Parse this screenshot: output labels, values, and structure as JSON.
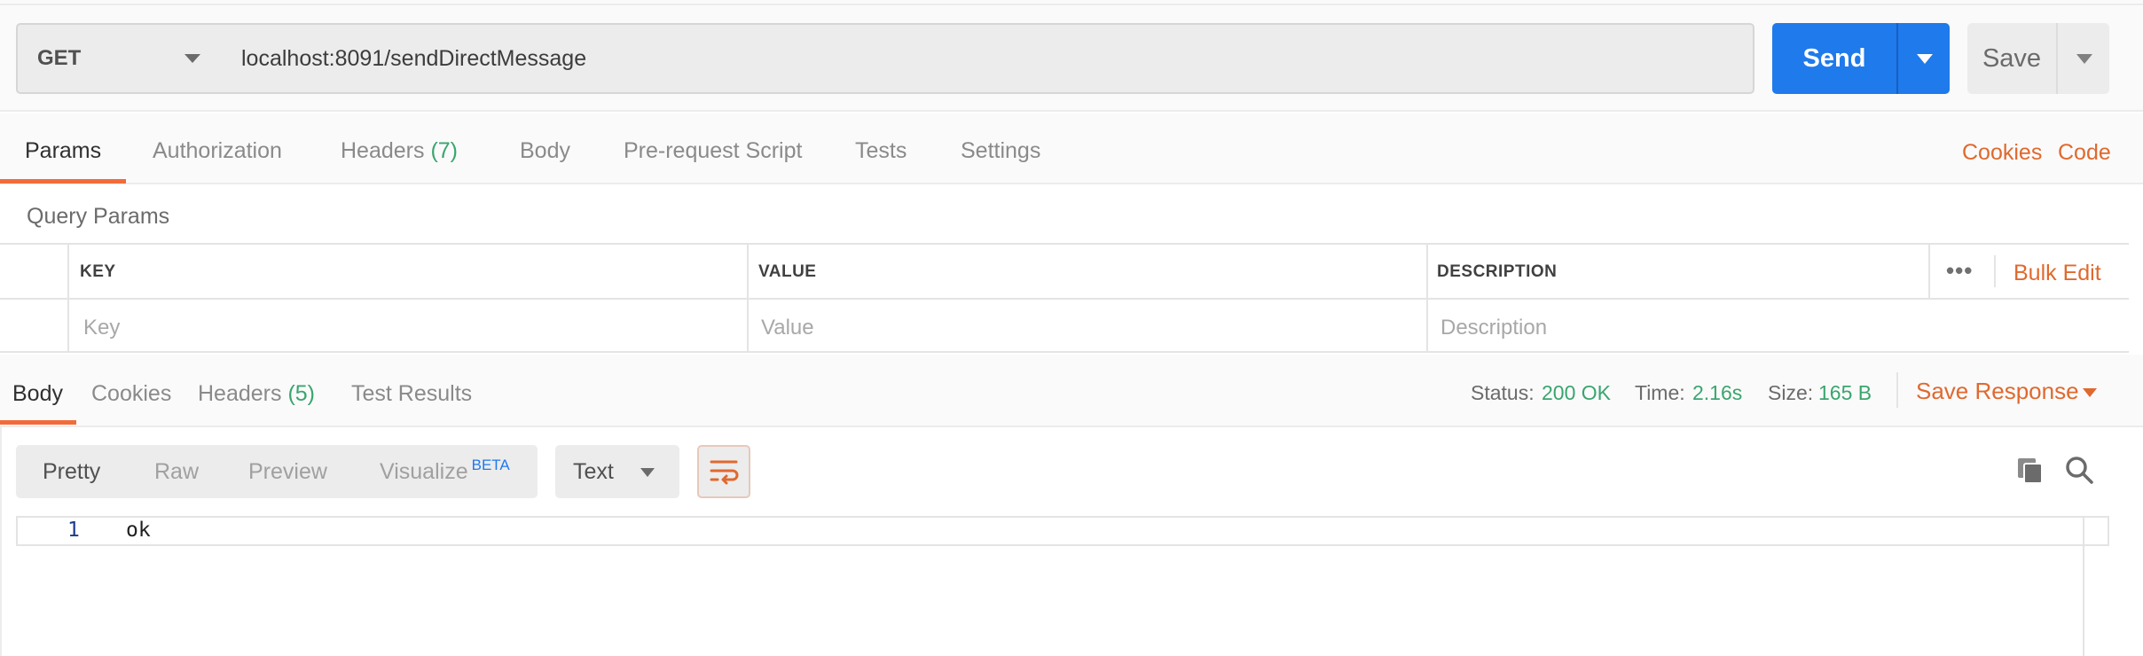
{
  "request": {
    "method": "GET",
    "url": "localhost:8091/sendDirectMessage",
    "send_label": "Send",
    "save_label": "Save"
  },
  "request_tabs": {
    "params": "Params",
    "authorization": "Authorization",
    "headers": "Headers",
    "headers_count": "(7)",
    "body": "Body",
    "prerequest": "Pre-request Script",
    "tests": "Tests",
    "settings": "Settings",
    "cookies": "Cookies",
    "code": "Code",
    "active": "Params"
  },
  "query_params": {
    "title": "Query Params",
    "columns": [
      "KEY",
      "VALUE",
      "DESCRIPTION"
    ],
    "placeholders": [
      "Key",
      "Value",
      "Description"
    ],
    "more": "•••",
    "bulk_edit": "Bulk Edit"
  },
  "response": {
    "tabs": {
      "body": "Body",
      "cookies": "Cookies",
      "headers": "Headers",
      "headers_count": "(5)",
      "test_results": "Test Results",
      "active": "Body"
    },
    "status_label": "Status:",
    "status_value": "200 OK",
    "time_label": "Time:",
    "time_value": "2.16s",
    "size_label": "Size:",
    "size_value": "165 B",
    "save_response": "Save Response"
  },
  "viewer": {
    "modes": [
      "Pretty",
      "Raw",
      "Preview",
      "Visualize"
    ],
    "beta_badge": "BETA",
    "active_mode": "Pretty",
    "format": "Text"
  },
  "editor": {
    "lines": [
      {
        "number": "1",
        "text": "ok"
      }
    ]
  },
  "colors": {
    "accent_blue": "#1f7aeb",
    "accent_orange": "#e0692e",
    "success_green": "#3aa56e"
  },
  "icons": [
    "chevron-down-icon",
    "wrap-lines-icon",
    "copy-icon",
    "search-icon",
    "more-icon"
  ]
}
